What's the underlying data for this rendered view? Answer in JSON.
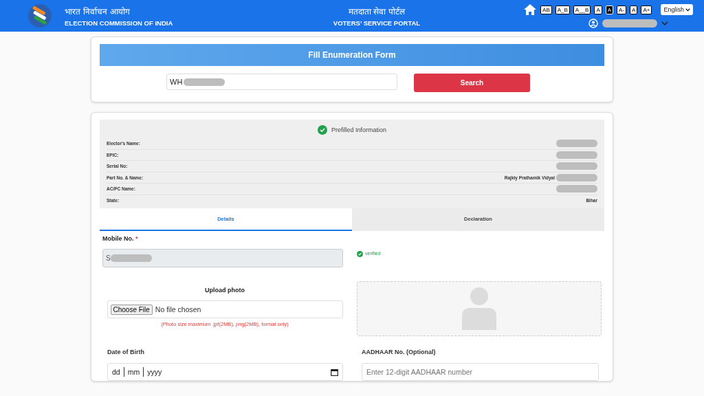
{
  "header": {
    "org_hindi": "भारत निर्वाचन आयोग",
    "org_english": "ELECTION COMMISSION OF INDIA",
    "portal_hindi": "मतदाता सेवा पोर्टल",
    "portal_english": "VOTERS’ SERVICE PORTAL",
    "spacing_buttons": [
      {
        "label": "AB"
      },
      {
        "label": "A_B"
      },
      {
        "label": "A__B"
      }
    ],
    "contrast_buttons": [
      {
        "label": "A",
        "selected": false
      },
      {
        "label": "A",
        "selected": true
      }
    ],
    "size_buttons": [
      {
        "label": "A-"
      },
      {
        "label": "A"
      },
      {
        "label": "A+"
      }
    ],
    "language": "English"
  },
  "search_card": {
    "title": "Fill Enumeration Form",
    "query": "WH",
    "button": "Search"
  },
  "prefilled": {
    "title": "Prefilled Information",
    "rows": [
      {
        "label": "Elector's Name:",
        "redacted": true
      },
      {
        "label": "EPIC:",
        "redacted": true
      },
      {
        "label": "Serial No:",
        "redacted": true
      },
      {
        "label": "Part No. & Name:",
        "value": "Rajkiy Prathamik Vidyal",
        "redacted": true
      },
      {
        "label": "AC/PC Name:",
        "redacted": true
      },
      {
        "label": "State:",
        "value": "Bihar",
        "redacted": false
      }
    ]
  },
  "tabs": [
    {
      "label": "Details",
      "selected": true
    },
    {
      "label": "Declaration",
      "selected": false
    }
  ],
  "form": {
    "mobile_label": "Mobile No.",
    "required_mark": "*",
    "mobile_value": "S",
    "verified": "verified",
    "upload_label": "Upload photo",
    "choose_button": "Choose File",
    "no_file": "No file chosen",
    "photo_hint": "(Photo size maximum .jpf(2MB), png(2MB), format only)",
    "dob_label": "Date of Birth",
    "dob_parts": [
      "dd",
      "mm",
      "yyyy"
    ],
    "aadhaar_label": "AADHAAR No. (Optional)",
    "aadhaar_placeholder": "Enter 12-digit AADHAAR number"
  }
}
